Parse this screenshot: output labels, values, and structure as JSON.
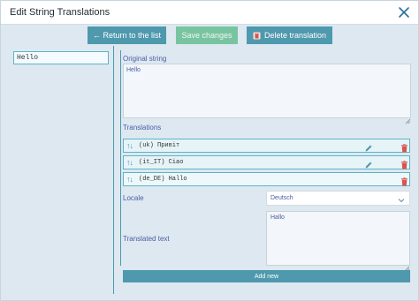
{
  "dialog": {
    "title": "Edit String Translations"
  },
  "toolbar": {
    "return_label": "← Return to the list",
    "save_label": "Save changes",
    "delete_label": "Delete translation"
  },
  "strings_list": {
    "items": [
      {
        "label": "Hello"
      }
    ]
  },
  "original": {
    "label": "Original string",
    "value": "Hello"
  },
  "translations": {
    "label": "Translations",
    "rows": [
      {
        "arrows": "↑↓",
        "text": "(uk) Привіт"
      },
      {
        "arrows": "↑↓",
        "text": "(it_IT) Ciao"
      },
      {
        "arrows": "↑↓",
        "text": "(de_DE) Hallo"
      }
    ]
  },
  "form": {
    "locale_label": "Locale",
    "locale_value": "Deutsch",
    "translated_label": "Translated text",
    "translated_value": "Hallo",
    "add_new_label": "Add new"
  },
  "colors": {
    "accent": "#4e99ad",
    "save_button": "#79c4a0",
    "danger_icon": "#d9534f",
    "label_text": "#4a5da8",
    "background": "#dde8f0"
  },
  "icons": {
    "close": "close-icon",
    "trash": "trash-icon",
    "edit": "pencil-icon",
    "sort": "sort-arrows-icon",
    "dropdown": "chevron-down-icon"
  }
}
